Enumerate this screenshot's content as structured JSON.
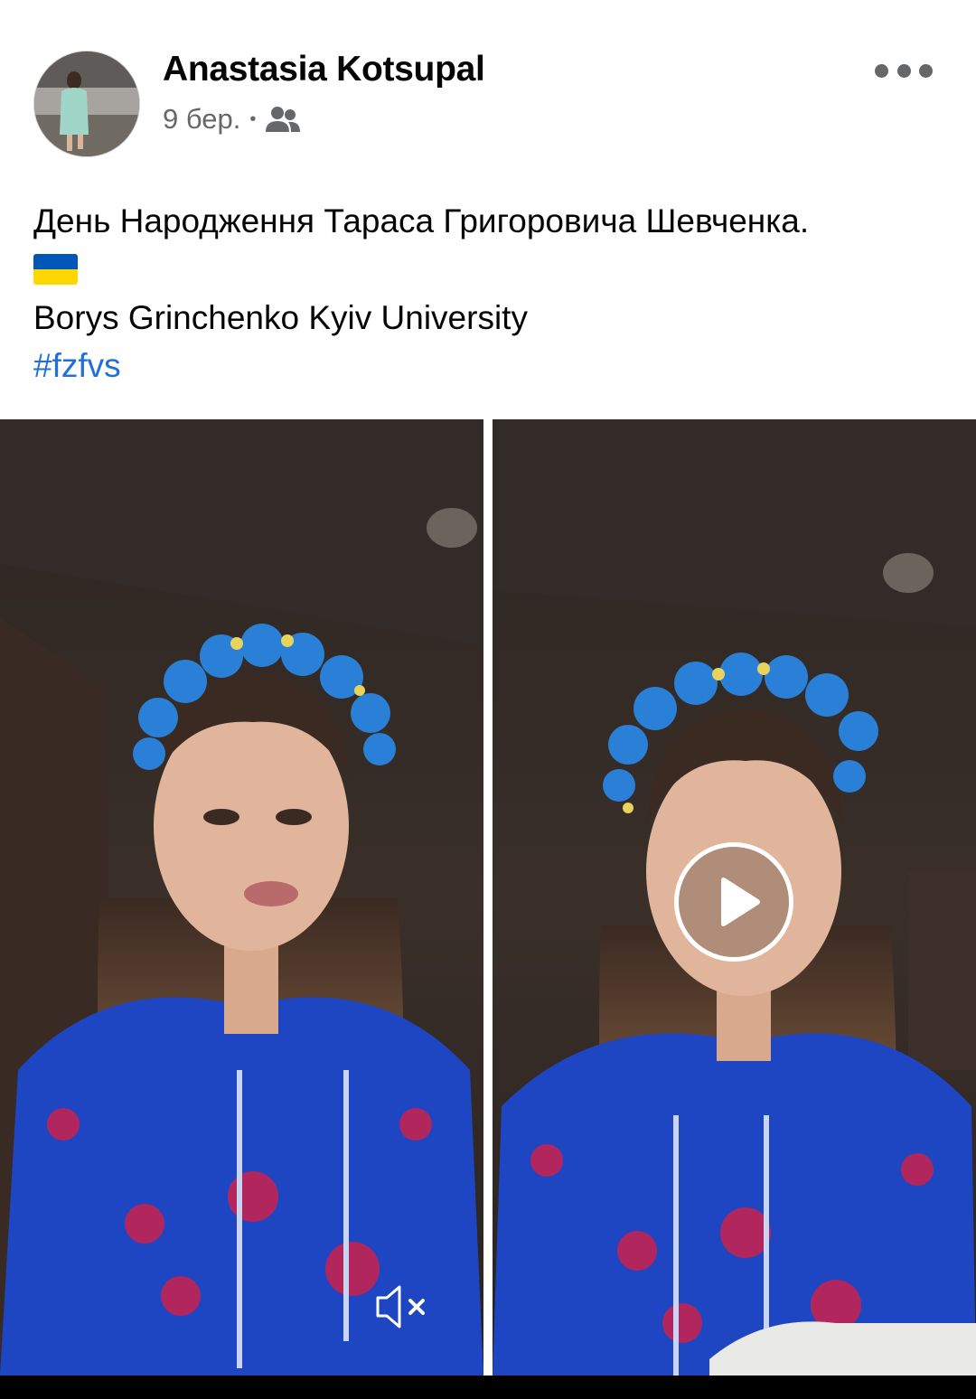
{
  "post": {
    "author": "Anastasia Kotsupal",
    "timestamp": "9 бер.",
    "separator": "•",
    "audience_icon": "friends-icon",
    "more_icon": "more-options-icon",
    "text_line1": "День Народження Тараса Григоровича Шевченка.",
    "flag_icon": "ukraine-flag-emoji",
    "text_line3": "Borys Grinchenko Kyiv University",
    "hashtag": "#fzfvs"
  },
  "media": {
    "videos": [
      {
        "name": "video-left",
        "control_icon": "muted-speaker-icon"
      },
      {
        "name": "video-right",
        "control_icon": "play-icon"
      }
    ]
  },
  "colors": {
    "text_primary": "#050505",
    "text_secondary": "#65676b",
    "link": "#216fdb",
    "flag_blue": "#0057b7",
    "flag_yellow": "#ffd700"
  }
}
